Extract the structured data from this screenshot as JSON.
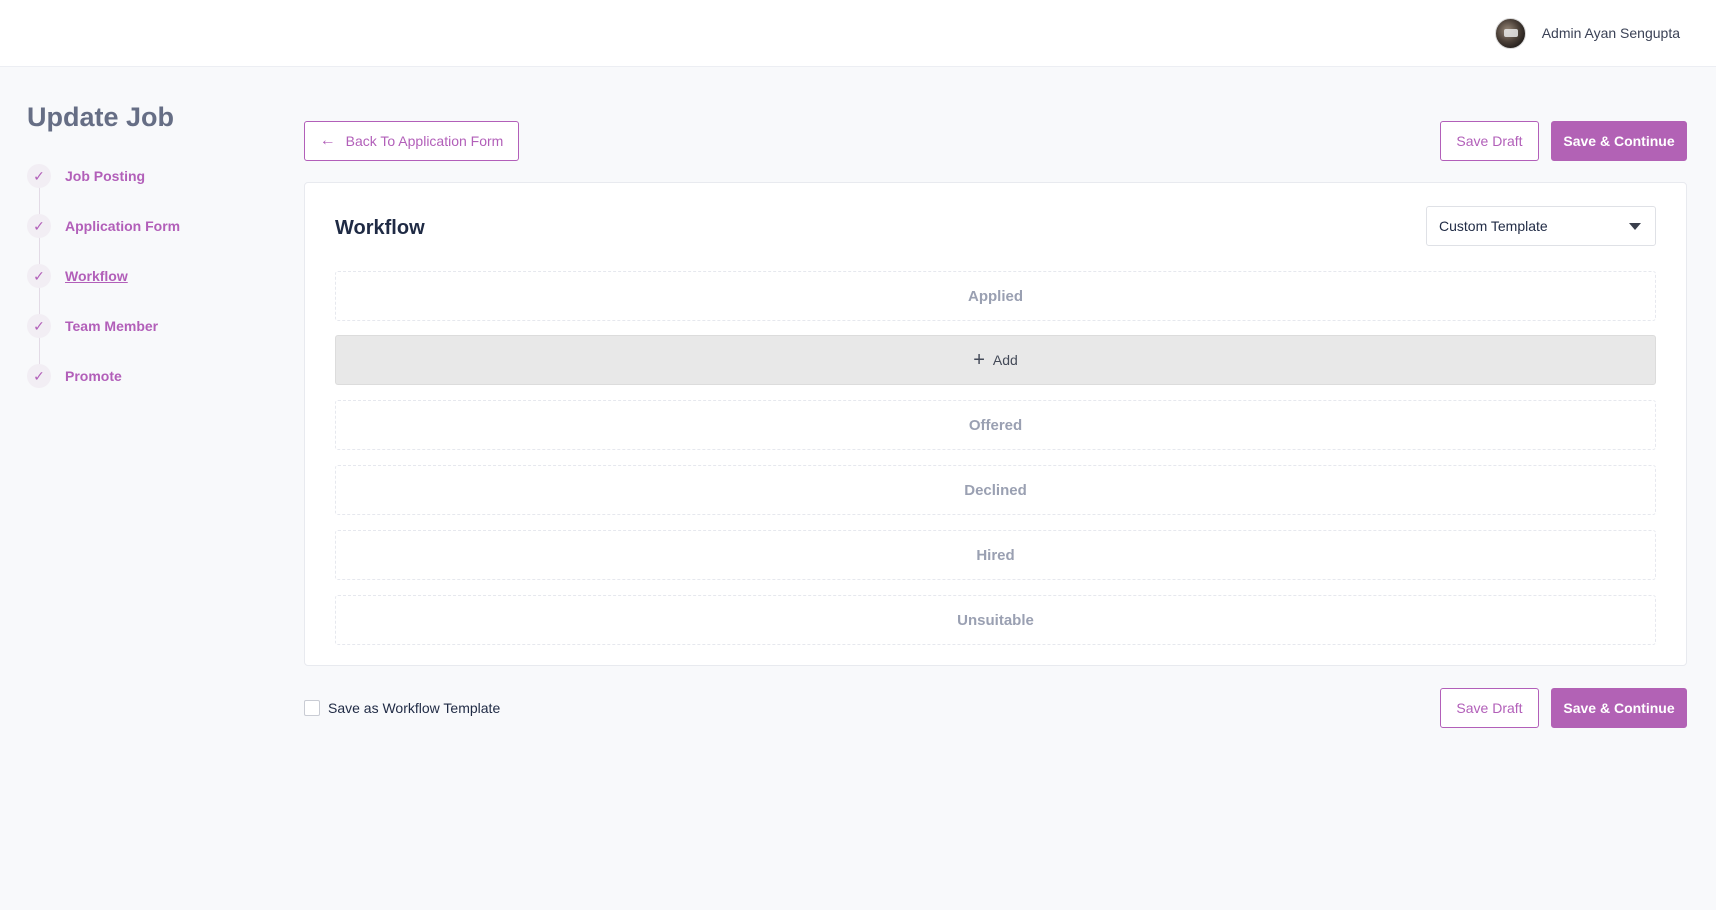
{
  "header": {
    "user_name": "Admin Ayan Sengupta"
  },
  "sidebar": {
    "title": "Update Job",
    "steps": [
      {
        "label": "Job Posting",
        "done": true,
        "active": false
      },
      {
        "label": "Application Form",
        "done": true,
        "active": false
      },
      {
        "label": "Workflow",
        "done": true,
        "active": true
      },
      {
        "label": "Team Member",
        "done": true,
        "active": false
      },
      {
        "label": "Promote",
        "done": true,
        "active": false
      }
    ]
  },
  "toolbar": {
    "back_label": "Back To Application Form",
    "save_draft_label": "Save Draft",
    "save_continue_label": "Save & Continue"
  },
  "workflow": {
    "title": "Workflow",
    "template_select": {
      "selected": "Custom Template"
    },
    "stages": {
      "first": "Applied",
      "rest": [
        "Offered",
        "Declined",
        "Hired",
        "Unsuitable"
      ]
    },
    "add_label": "Add"
  },
  "footer": {
    "checkbox_label": "Save as Workflow Template",
    "save_draft_label": "Save Draft",
    "save_continue_label": "Save & Continue"
  },
  "colors": {
    "accent": "#b262b5",
    "muted_text": "#9aa0b2"
  }
}
